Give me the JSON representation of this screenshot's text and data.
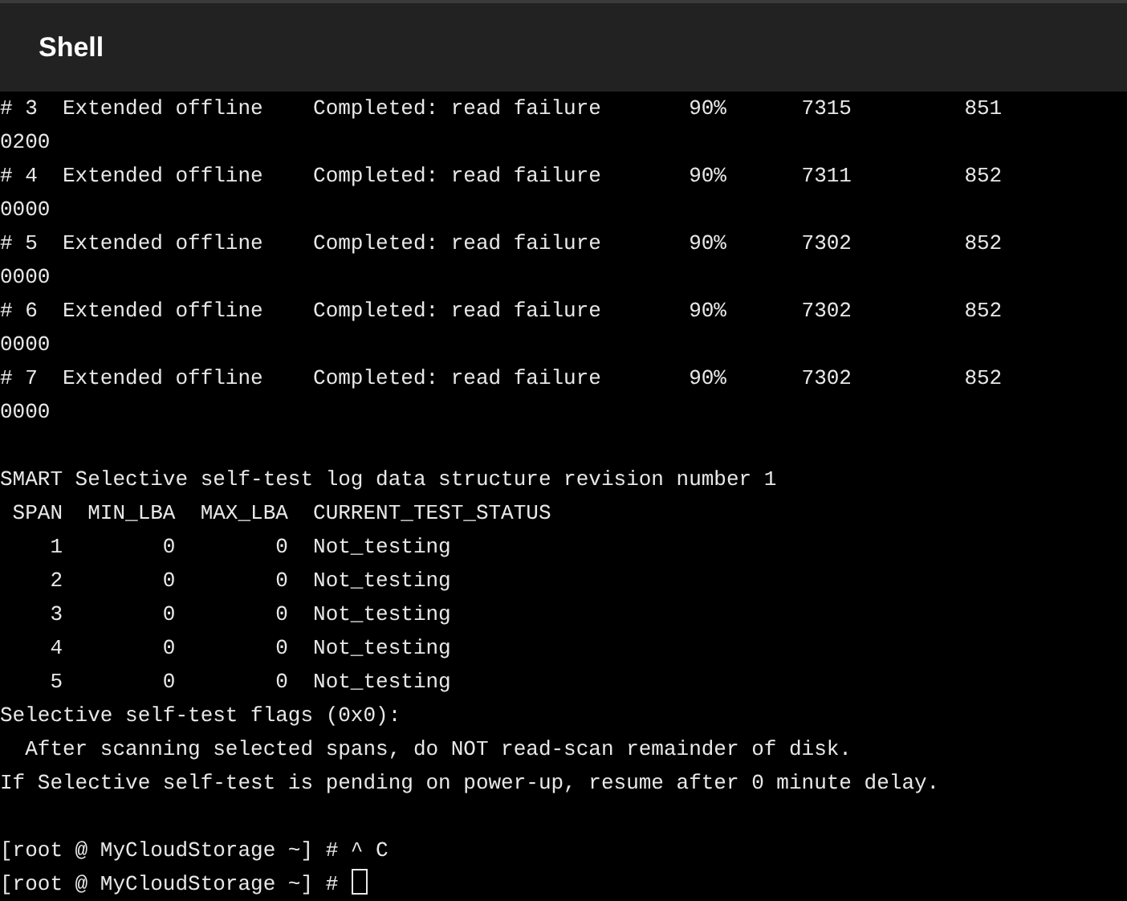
{
  "header": {
    "title": "Shell"
  },
  "terminal": {
    "lines": [
      {
        "kind": "output",
        "text": "# 3  Extended offline    Completed: read failure       90%      7315         851"
      },
      {
        "kind": "output",
        "text": "0200"
      },
      {
        "kind": "output",
        "text": "# 4  Extended offline    Completed: read failure       90%      7311         852"
      },
      {
        "kind": "output",
        "text": "0000"
      },
      {
        "kind": "output",
        "text": "# 5  Extended offline    Completed: read failure       90%      7302         852"
      },
      {
        "kind": "output",
        "text": "0000"
      },
      {
        "kind": "output",
        "text": "# 6  Extended offline    Completed: read failure       90%      7302         852"
      },
      {
        "kind": "output",
        "text": "0000"
      },
      {
        "kind": "output",
        "text": "# 7  Extended offline    Completed: read failure       90%      7302         852"
      },
      {
        "kind": "output",
        "text": "0000"
      },
      {
        "kind": "blank"
      },
      {
        "kind": "output",
        "text": "SMART Selective self-test log data structure revision number 1"
      },
      {
        "kind": "output",
        "text": " SPAN  MIN_LBA  MAX_LBA  CURRENT_TEST_STATUS"
      },
      {
        "kind": "output",
        "text": "    1        0        0  Not_testing"
      },
      {
        "kind": "output",
        "text": "    2        0        0  Not_testing"
      },
      {
        "kind": "output",
        "text": "    3        0        0  Not_testing"
      },
      {
        "kind": "output",
        "text": "    4        0        0  Not_testing"
      },
      {
        "kind": "output",
        "text": "    5        0        0  Not_testing"
      },
      {
        "kind": "output",
        "text": "Selective self-test flags (0x0):"
      },
      {
        "kind": "output",
        "text": "  After scanning selected spans, do NOT read-scan remainder of disk."
      },
      {
        "kind": "output",
        "text": "If Selective self-test is pending on power-up, resume after 0 minute delay."
      },
      {
        "kind": "blank"
      },
      {
        "kind": "prompt",
        "text": "[root @ MyCloudStorage ~] # ^ C",
        "cursor": false
      },
      {
        "kind": "prompt",
        "text": "[root @ MyCloudStorage ~] #",
        "cursor": true
      }
    ]
  }
}
